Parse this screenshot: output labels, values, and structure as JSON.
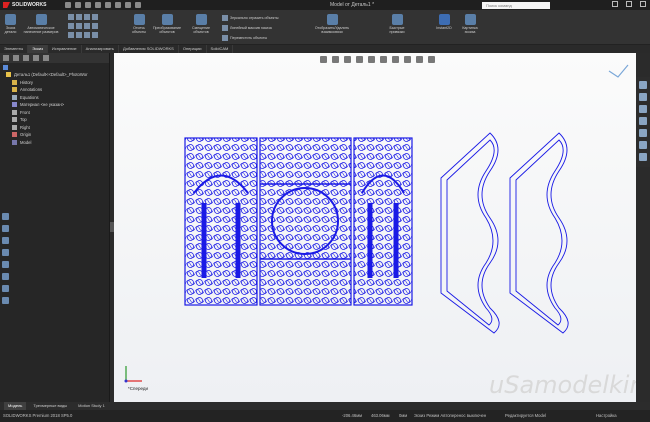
{
  "app": {
    "name": "SOLIDWORKS",
    "doc_title": "Model от Деталь1 *",
    "search_placeholder": "Поиск команд"
  },
  "ribbon": {
    "items": [
      {
        "label": "Эскиз детали"
      },
      {
        "label": "Автоматическое нанесение размеров"
      },
      {
        "label": "Отсечь объекты"
      },
      {
        "label": "Преобразование объектов"
      },
      {
        "label": "Смещение объектов"
      },
      {
        "label": "Отобразить/Удалить взаимосвязи"
      },
      {
        "label": "Быстрые привязки"
      },
      {
        "label": "Instant2D"
      },
      {
        "label": "Картинка эскиза"
      }
    ],
    "rows": [
      {
        "label": "Зеркально отразить объекты"
      },
      {
        "label": "Линейный массив эскиза"
      },
      {
        "label": "Переместить объекты"
      }
    ]
  },
  "tabs": [
    {
      "label": "Элементы"
    },
    {
      "label": "Эскиз"
    },
    {
      "label": "Исправление"
    },
    {
      "label": "Анализировать"
    },
    {
      "label": "Добавления SOLIDWORKS"
    },
    {
      "label": "Операции"
    },
    {
      "label": "SolidCAM"
    }
  ],
  "tree": {
    "root": "Деталь1 (Default<<Default>_PhotoWor",
    "items": [
      {
        "label": "History"
      },
      {
        "label": "Annotations"
      },
      {
        "label": "Equations"
      },
      {
        "label": "Материал <не указан>"
      },
      {
        "label": "Front"
      },
      {
        "label": "Top"
      },
      {
        "label": "Right"
      },
      {
        "label": "Origin"
      },
      {
        "label": "Model"
      }
    ]
  },
  "viewport": {
    "view_label": "*Спереди",
    "watermark": "uSamodelkino.ru"
  },
  "bottom_tabs": [
    {
      "label": "Модель"
    },
    {
      "label": "Трехмерные виды"
    },
    {
      "label": "Motion Study 1"
    }
  ],
  "status": {
    "version": "SOLIDWORKS Premium 2018 SP5.0",
    "x": "-206.46мм",
    "y": "463.06мм",
    "z": "0мм",
    "state": "Эскиз Режим Автоперенос выключен",
    "editing": "Редактируется Model",
    "settings": "Настройка"
  },
  "colors": {
    "geometry": "#1a1ae6",
    "ribbon_bg": "#333333",
    "viewport_top": "#fbfbfb"
  }
}
